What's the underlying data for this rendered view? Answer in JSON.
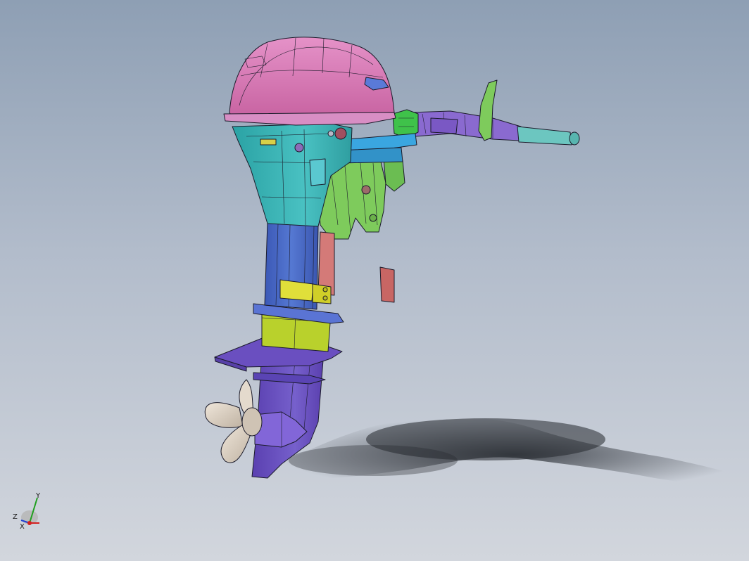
{
  "viewport": {
    "background_top": "#8e9fb4",
    "background_bottom": "#d2d6dd",
    "model": "outboard-motor-assembly"
  },
  "colors": {
    "cowl": "#d77ab8",
    "upper_housing": "#3fb6b8",
    "midsection": "#4a69c6",
    "collar": "#b9d12c",
    "lower_unit": "#6a4fc0",
    "propeller": "#ded2c4",
    "clamp_bracket": "#7ecb5c",
    "tiller": "#8a6ad0",
    "grip": "#6cc6c0",
    "shift_lever": "#3fc24a",
    "swivel_tube": "#d47a78",
    "yellow_block": "#e0df3a",
    "shadow": "#1e2228"
  },
  "triad": {
    "x_label": "X",
    "y_label": "Y",
    "z_label": "Z",
    "x_color": "#d42020",
    "y_color": "#20a020",
    "z_color": "#2040d0"
  }
}
